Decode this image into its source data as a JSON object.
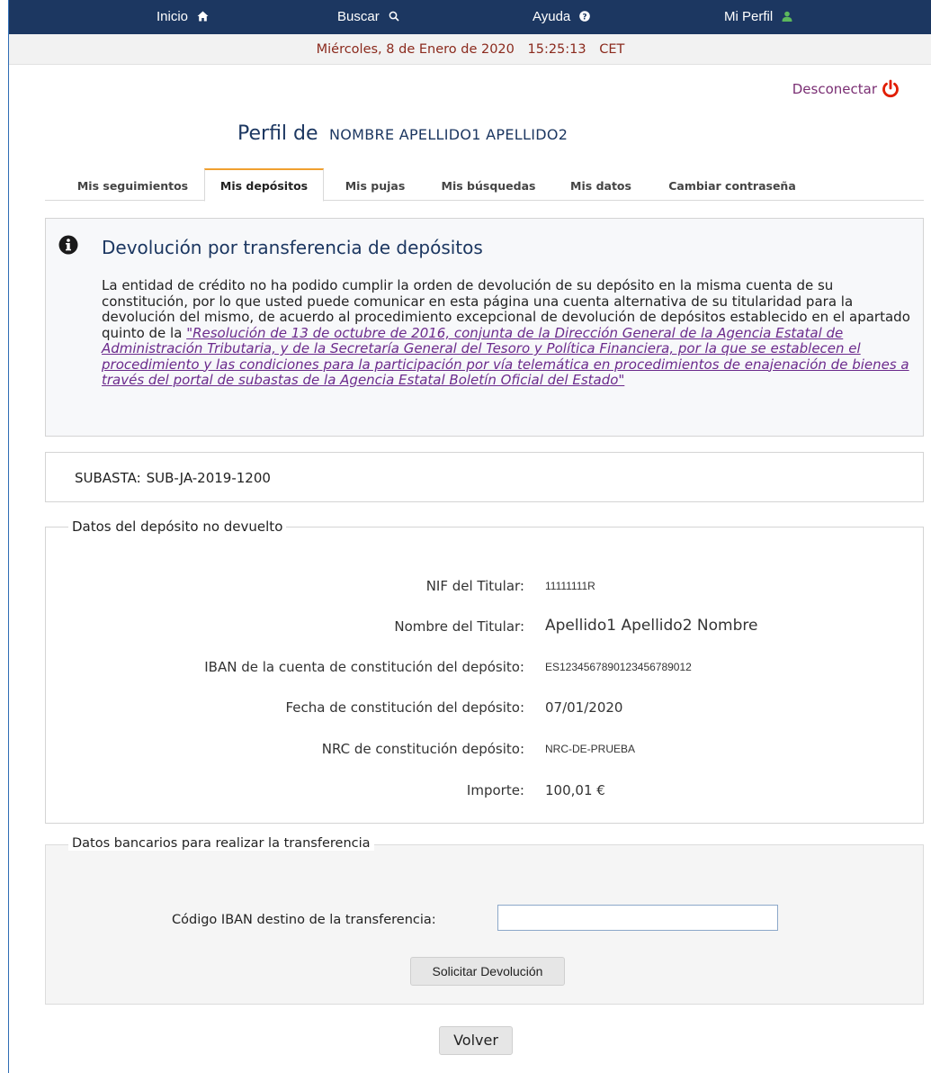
{
  "nav": {
    "inicio": "Inicio",
    "buscar": "Buscar",
    "ayuda": "Ayuda",
    "perfil": "Mi Perfil"
  },
  "datebar": {
    "date": "Miércoles, 8 de Enero de 2020",
    "time": "15:25:13",
    "tz": "CET"
  },
  "logout_label": "Desconectar",
  "profile": {
    "label": "Perfil de",
    "name": "NOMBRE  APELLIDO1  APELLIDO2"
  },
  "tabs": [
    {
      "label": "Mis seguimientos",
      "active": false
    },
    {
      "label": "Mis depósitos",
      "active": true
    },
    {
      "label": "Mis pujas",
      "active": false
    },
    {
      "label": "Mis búsquedas",
      "active": false
    },
    {
      "label": "Mis datos",
      "active": false
    },
    {
      "label": "Cambiar contraseña",
      "active": false
    }
  ],
  "info": {
    "title": "Devolución por transferencia de depósitos",
    "text": "La entidad de crédito no ha podido cumplir la orden de devolución de su depósito en la misma cuenta de su constitución, por lo que usted puede comunicar en esta página una cuenta alternativa de su titularidad para la devolución del mismo, de acuerdo al procedimiento excepcional de devolución de depósitos establecido en el apartado quinto de la ",
    "link": "\"Resolución de 13 de octubre de 2016, conjunta de la Dirección General de la Agencia Estatal de Administración Tributaria, y de la Secretaría General del Tesoro y Política Financiera, por la que se establecen el procedimiento y las condiciones para la participación por vía telemática en procedimientos de enajenación de bienes a través del portal de subastas de la Agencia Estatal Boletín Oficial del Estado\""
  },
  "subasta": {
    "label": "SUBASTA:",
    "value": "SUB-JA-2019-1200"
  },
  "deposito": {
    "legend": "Datos del depósito no devuelto",
    "nif_label": "NIF del Titular:",
    "nif": "11111111R",
    "nombre_label": "Nombre del Titular:",
    "nombre": "Apellido1  Apellido2  Nombre",
    "iban_label": "IBAN de la cuenta de constitución del depósito:",
    "iban": "ES1234567890123456789012",
    "fecha_label": "Fecha de constitución del depósito:",
    "fecha": "07/01/2020",
    "nrc_label": "NRC de constitución depósito:",
    "nrc": "NRC-DE-PRUEBA",
    "importe_label": "Importe:",
    "importe": "100,01 €"
  },
  "bancarios": {
    "legend": "Datos bancarios para realizar la transferencia",
    "iban_dest_label": "Código IBAN destino de la transferencia:",
    "iban_dest_value": "",
    "solicitar": "Solicitar Devolución"
  },
  "volver": "Volver",
  "colors": {
    "nav_bg": "#1c3761",
    "date_text": "#8b2a1d",
    "tab_accent": "#f0a030",
    "link": "#6b2a8c",
    "logout_icon": "#e11d00",
    "profile_icon": "#5cb85c"
  }
}
